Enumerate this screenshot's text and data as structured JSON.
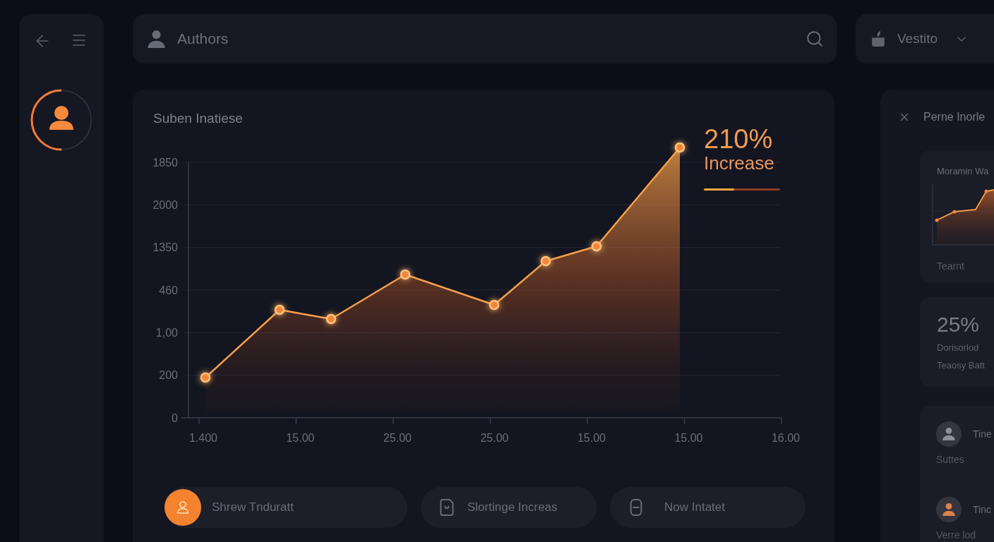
{
  "sidebar": {
    "avatar": {
      "level": 0.5
    }
  },
  "header": {
    "title": "Authors"
  },
  "account": {
    "label": "Vestito"
  },
  "chart_card": {
    "title": "Suben Inatiese",
    "y_labels": [
      "1850",
      "2000",
      "1350",
      "460",
      "1,00",
      "200",
      "0"
    ],
    "x_labels": [
      "1.400",
      "15.00",
      "25.00",
      "25.00",
      "15.00",
      "15.00",
      "16.00"
    ],
    "callout": {
      "value": "210%",
      "label": "Increase",
      "level": 0.4
    }
  },
  "actions": [
    {
      "label": "Shrew Tnduratt",
      "selected": true
    },
    {
      "label": "Slortinge Increas",
      "selected": false
    },
    {
      "label": "Now Intatet",
      "selected": false
    }
  ],
  "panel": {
    "title": "Perne Inorle",
    "trend_card": {
      "title": "Moramin Wa",
      "caption": "Tearnt"
    },
    "stat_card": {
      "value": "25%",
      "lines": [
        "Dorisorlod",
        "Teaosy Batt"
      ]
    },
    "people": [
      {
        "name": "Tine",
        "caption": "Suttes",
        "color": "#8e909c"
      },
      {
        "name": "Tinc",
        "caption": "Verre lod",
        "color": "#e0824a"
      }
    ]
  }
}
